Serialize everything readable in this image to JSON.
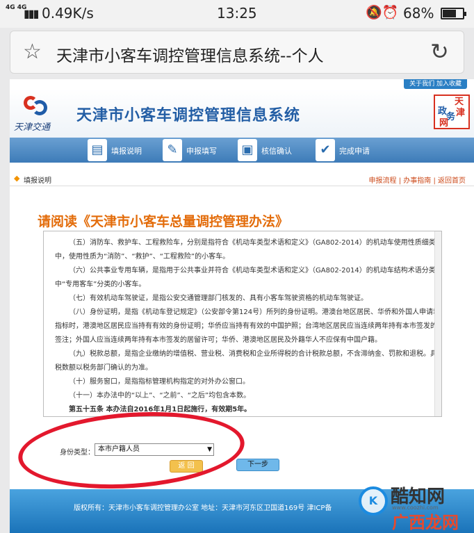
{
  "statusbar": {
    "network": "4G 4G",
    "speed": "0.49K/s",
    "time": "13:25",
    "battery_pct": "68%",
    "battery_level": 0.68
  },
  "browser": {
    "tab_title": "天津市小客车调控管理信息系统--个人"
  },
  "site": {
    "top_links": "关于我们  加入收藏",
    "logo_text": "天津交通",
    "title": "天津市小客车调控管理信息系统",
    "stamp_chars": [
      "政",
      "天",
      "务",
      "津",
      "网"
    ],
    "steps": [
      {
        "label": "填报说明",
        "icon": "doc-icon"
      },
      {
        "label": "申报填写",
        "icon": "edit-icon"
      },
      {
        "label": "核信确认",
        "icon": "confirm-icon"
      },
      {
        "label": "完成申请",
        "icon": "check-icon"
      }
    ],
    "crumb_current": "填报说明",
    "crumb_links": "申报流程 | 办事指南 | 返回首页",
    "notice_title": "请阅读《天津市小客车总量调控管理办法》",
    "clauses": [
      {
        "first": "（五）消防车、救护车、工程救险车，分别是指符合《机动车类型术语和定义》（GA802-2014）的机动车使用性质细类表",
        "rest": [
          "中，使用性质为“消防”、“救护”、“工程救险”的小客车。"
        ]
      },
      {
        "first": "（六）公共事业专用车辆，是指用于公共事业并符合《机动车类型术语和定义》（GA802-2014）的机动车结构术语分类表",
        "rest": [
          "中“专用客车”分类的小客车。"
        ]
      },
      {
        "first": "（七）有效机动车驾驶证，是指公安交通管理部门核发的、具有小客车驾驶资格的机动车驾驶证。",
        "rest": []
      },
      {
        "first": "（八）身份证明，是指《机动车登记规定》（公安部令第124号）所列的身份证明。港澳台地区居民、华侨和外国人申请增量",
        "rest": [
          "指标时，港澳地区居民应当持有有效的身份证明；华侨应当持有有效的中国护照；台湾地区居民应当连续两年持有本市签发的居留",
          "签注；外国人应当连续两年持有本市签发的居留许可；华侨、港澳地区居民及外籍华人不应保有中国户籍。"
        ]
      },
      {
        "first": "（九）税款总额，是指企业缴纳的增值税、营业税、消费税和企业所得税的合计税款总额，不含滞纳金、罚款和退税。具体纳",
        "rest": [
          "税数额以税务部门确认的为准。"
        ]
      },
      {
        "first": "（十）服务窗口，是指指标管理机构指定的对外办公窗口。",
        "rest": []
      },
      {
        "first": "（十一）本办法中的“以上”、“之前”、“之后”均包含本数。",
        "rest": []
      }
    ],
    "last_article": "第五十五条  本办法自2016年1月1日起施行，有效期5年。",
    "id_type_label": "身份类型：",
    "id_type_value": "本市户籍人员",
    "back_label": "返 回",
    "next_label": "下一步",
    "footer_text": "版权所有：天津市小客车调控管理办公室    地址：天津市河东区卫国道169号    津ICP备"
  },
  "watermark": {
    "logo": "K",
    "line1": "酷知网",
    "url": "www.coozhi.com",
    "line2": "广西龙网"
  },
  "colors": {
    "title_blue": "#235ea5",
    "notice_orange": "#e36c0a",
    "annotation_red": "#e3182d",
    "footer_blue": "#1a73b9"
  }
}
